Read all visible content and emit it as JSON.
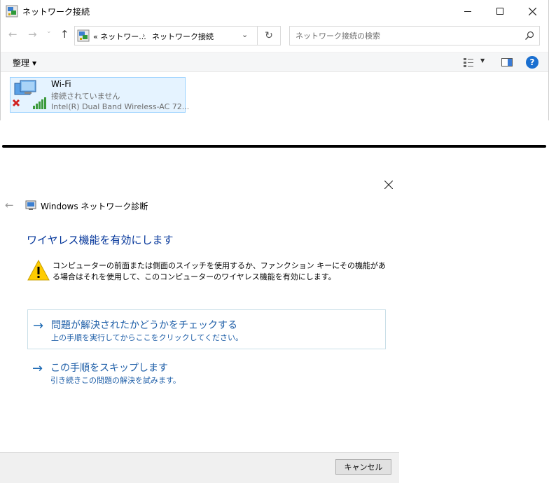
{
  "explorer": {
    "title": "ネットワーク接続",
    "address": {
      "prefix": "«",
      "crumb1": "ネットワー...",
      "separator": "›",
      "crumb2": "ネットワーク接続"
    },
    "search_placeholder": "ネットワーク接続の検索",
    "toolbar": {
      "organize_label": "整理"
    },
    "adapter": {
      "name": "Wi-Fi",
      "status": "接続されていません",
      "device": "Intel(R) Dual Band Wireless-AC 72..."
    }
  },
  "diagnostics": {
    "app_title": "Windows ネットワーク診断",
    "heading": "ワイヤレス機能を有効にします",
    "warning_text": "コンピューターの前面または側面のスイッチを使用するか、ファンクション キーにその機能がある場合はそれを使用して、このコンピューターのワイヤレス機能を有効にします。",
    "options": [
      {
        "title": "問題が解決されたかどうかをチェックする",
        "description": "上の手順を実行してからここをクリックしてください。"
      },
      {
        "title": "この手順をスキップします",
        "description": "引き続きこの問題の解決を試みます。"
      }
    ],
    "cancel_label": "キャンセル"
  },
  "colors": {
    "link_blue": "#1f5fa8",
    "heading_blue": "#003399",
    "selection_bg": "#e5f3ff",
    "selection_border": "#99d1ff"
  }
}
